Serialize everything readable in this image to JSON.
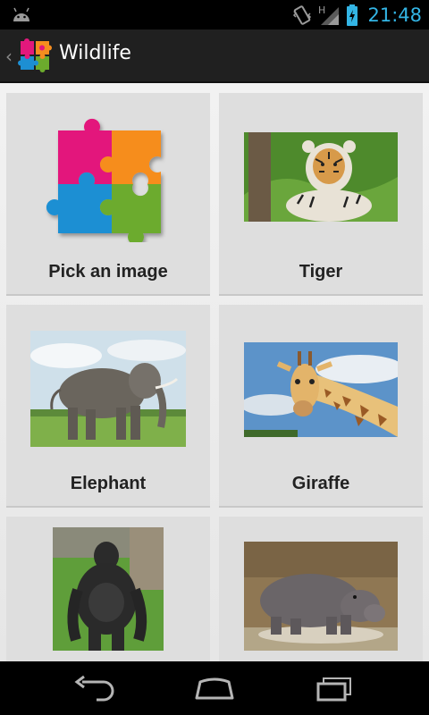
{
  "status_bar": {
    "time": "21:48",
    "network_label": "H",
    "icons": [
      "android-icon",
      "vibrate-icon",
      "signal-icon",
      "battery-icon"
    ]
  },
  "action_bar": {
    "title": "Wildlife",
    "logo_icon": "puzzle-icon"
  },
  "tiles": [
    {
      "label": "Pick an image",
      "icon": "puzzle-icon"
    },
    {
      "label": "Tiger",
      "icon": "tiger-photo"
    },
    {
      "label": "Elephant",
      "icon": "elephant-photo"
    },
    {
      "label": "Giraffe",
      "icon": "giraffe-photo"
    },
    {
      "label": "",
      "icon": "gorilla-photo"
    },
    {
      "label": "",
      "icon": "hippo-photo"
    }
  ],
  "nav_bar": {
    "buttons": [
      "back-icon",
      "home-icon",
      "recents-icon"
    ]
  },
  "colors": {
    "accent": "#33b5e5",
    "action_bar": "#202020",
    "tile_bg": "#dedede"
  }
}
